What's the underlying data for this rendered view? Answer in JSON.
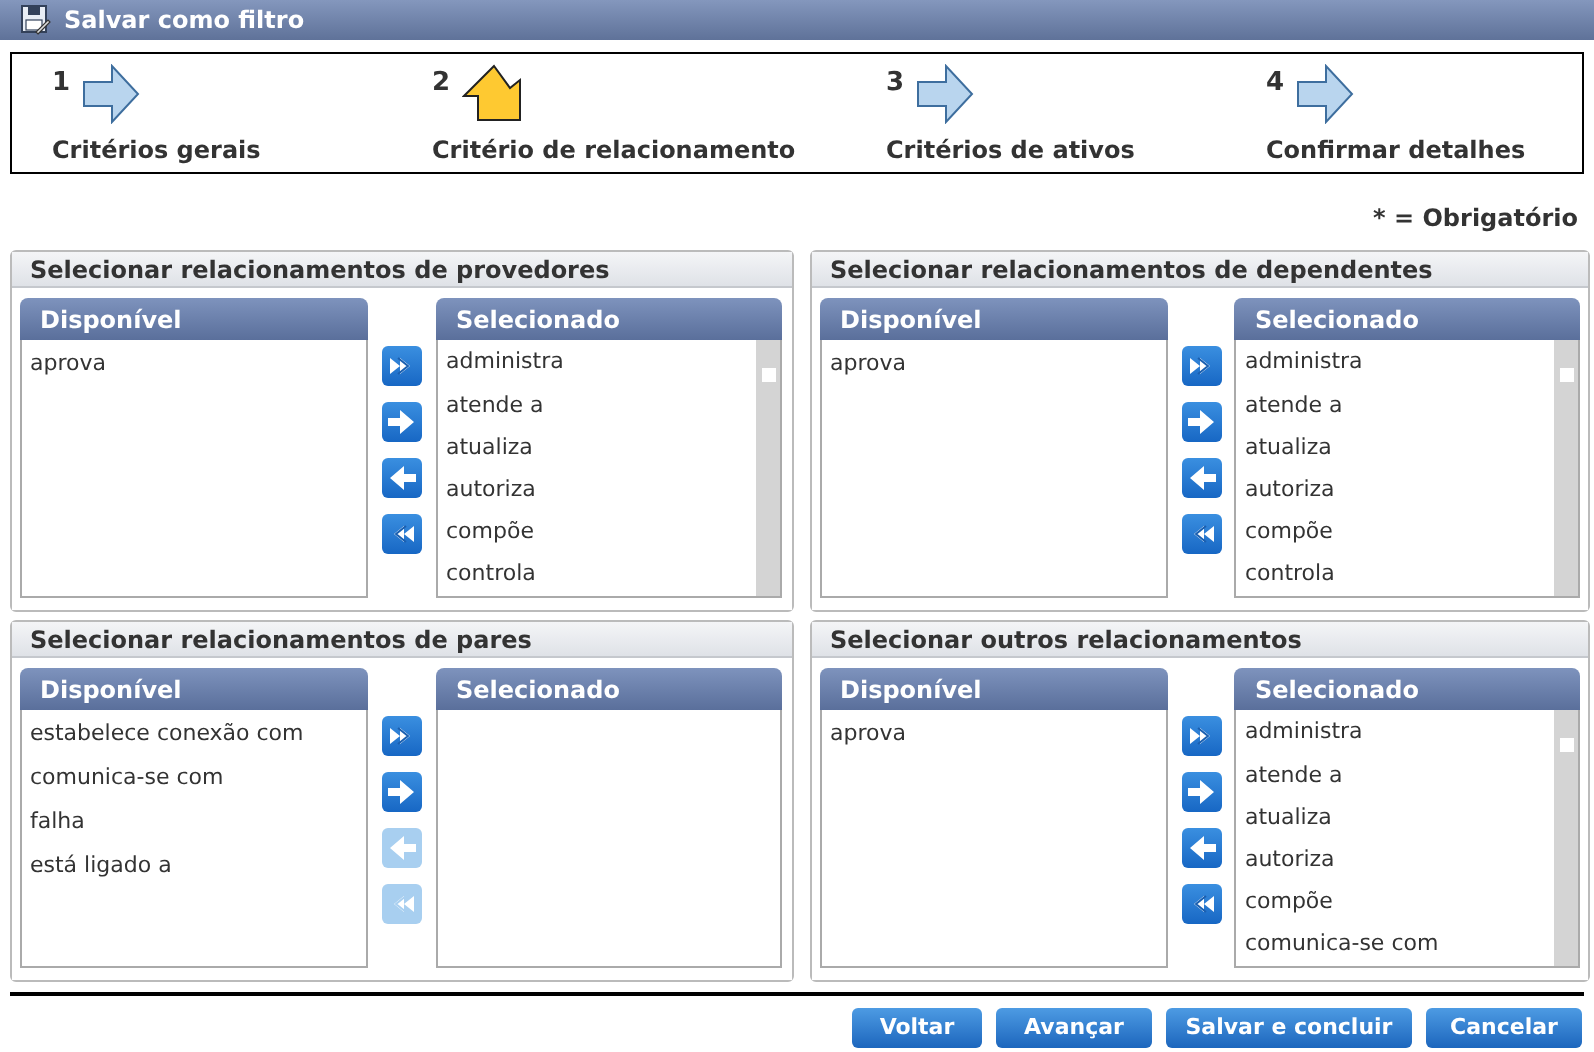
{
  "window": {
    "title": "Salvar como filtro"
  },
  "steps": [
    {
      "number": "1",
      "label": "Critérios gerais",
      "current": false
    },
    {
      "number": "2",
      "label": "Critério de relacionamento",
      "current": true
    },
    {
      "number": "3",
      "label": "Critérios de ativos",
      "current": false
    },
    {
      "number": "4",
      "label": "Confirmar detalhes",
      "current": false
    }
  ],
  "required_note": "* = Obrigatório",
  "panels": [
    {
      "title": "Selecionar relacionamentos de provedores",
      "available": {
        "header": "Disponível",
        "scrollable": false,
        "items": [
          "aprova"
        ]
      },
      "transfer_buttons": [
        {
          "kind": "add_all",
          "disabled": false
        },
        {
          "kind": "add",
          "disabled": false
        },
        {
          "kind": "remove",
          "disabled": false
        },
        {
          "kind": "remove_all",
          "disabled": false
        }
      ],
      "selected": {
        "header": "Selecionado",
        "scrollable": true,
        "items": [
          "administra",
          "atende a",
          "atualiza",
          "autoriza",
          "compõe",
          "controla"
        ]
      }
    },
    {
      "title": "Selecionar relacionamentos de dependentes",
      "available": {
        "header": "Disponível",
        "scrollable": false,
        "items": [
          "aprova"
        ]
      },
      "transfer_buttons": [
        {
          "kind": "add_all",
          "disabled": false
        },
        {
          "kind": "add",
          "disabled": false
        },
        {
          "kind": "remove",
          "disabled": false
        },
        {
          "kind": "remove_all",
          "disabled": false
        }
      ],
      "selected": {
        "header": "Selecionado",
        "scrollable": true,
        "items": [
          "administra",
          "atende a",
          "atualiza",
          "autoriza",
          "compõe",
          "controla"
        ]
      }
    },
    {
      "title": "Selecionar relacionamentos de pares",
      "available": {
        "header": "Disponível",
        "scrollable": false,
        "items": [
          "estabelece conexão com",
          "comunica-se com",
          "falha",
          "está ligado a"
        ]
      },
      "transfer_buttons": [
        {
          "kind": "add_all",
          "disabled": false
        },
        {
          "kind": "add",
          "disabled": false
        },
        {
          "kind": "remove",
          "disabled": true
        },
        {
          "kind": "remove_all",
          "disabled": true
        }
      ],
      "selected": {
        "header": "Selecionado",
        "scrollable": false
      }
    },
    {
      "title": "Selecionar outros relacionamentos",
      "available": {
        "header": "Disponível",
        "scrollable": false,
        "items": [
          "aprova"
        ]
      },
      "transfer_buttons": [
        {
          "kind": "add_all",
          "disabled": false
        },
        {
          "kind": "add",
          "disabled": false
        },
        {
          "kind": "remove",
          "disabled": false
        },
        {
          "kind": "remove_all",
          "disabled": false
        }
      ],
      "selected": {
        "header": "Selecionado",
        "scrollable": true,
        "items": [
          "administra",
          "atende a",
          "atualiza",
          "autoriza",
          "compõe",
          "comunica-se com"
        ]
      }
    }
  ],
  "buttons": [
    "Voltar",
    "Avançar",
    "Salvar e concluir",
    "Cancelar"
  ]
}
